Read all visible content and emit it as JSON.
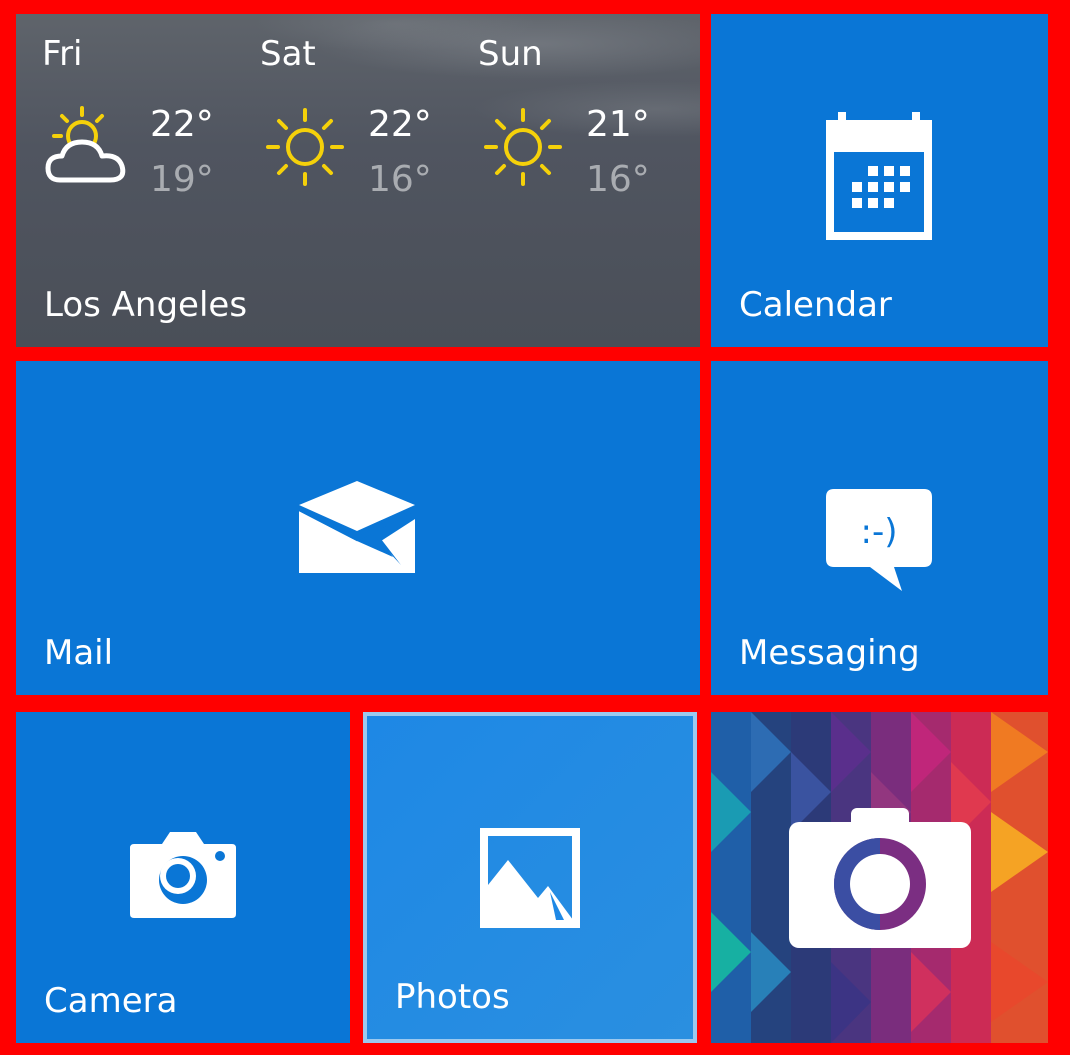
{
  "weather": {
    "city": "Los Angeles",
    "days": [
      {
        "name": "Fri",
        "high": "22°",
        "low": "19°",
        "icon": "partly-cloudy-icon"
      },
      {
        "name": "Sat",
        "high": "22°",
        "low": "16°",
        "icon": "sunny-icon"
      },
      {
        "name": "Sun",
        "high": "21°",
        "low": "16°",
        "icon": "sunny-icon"
      }
    ]
  },
  "tiles": {
    "calendar": {
      "label": "Calendar",
      "icon": "calendar-icon"
    },
    "mail": {
      "label": "Mail",
      "icon": "mail-icon"
    },
    "messaging": {
      "label": "Messaging",
      "icon": "messaging-icon"
    },
    "camera": {
      "label": "Camera",
      "icon": "camera-icon"
    },
    "photos": {
      "label": "Photos",
      "icon": "photos-icon"
    },
    "camera360": {
      "label": "",
      "icon": "camera-app-icon"
    }
  },
  "colors": {
    "tile_blue": "#0a76d6",
    "highlight_border": "#ff0000",
    "sun_yellow": "#f5d10a"
  }
}
